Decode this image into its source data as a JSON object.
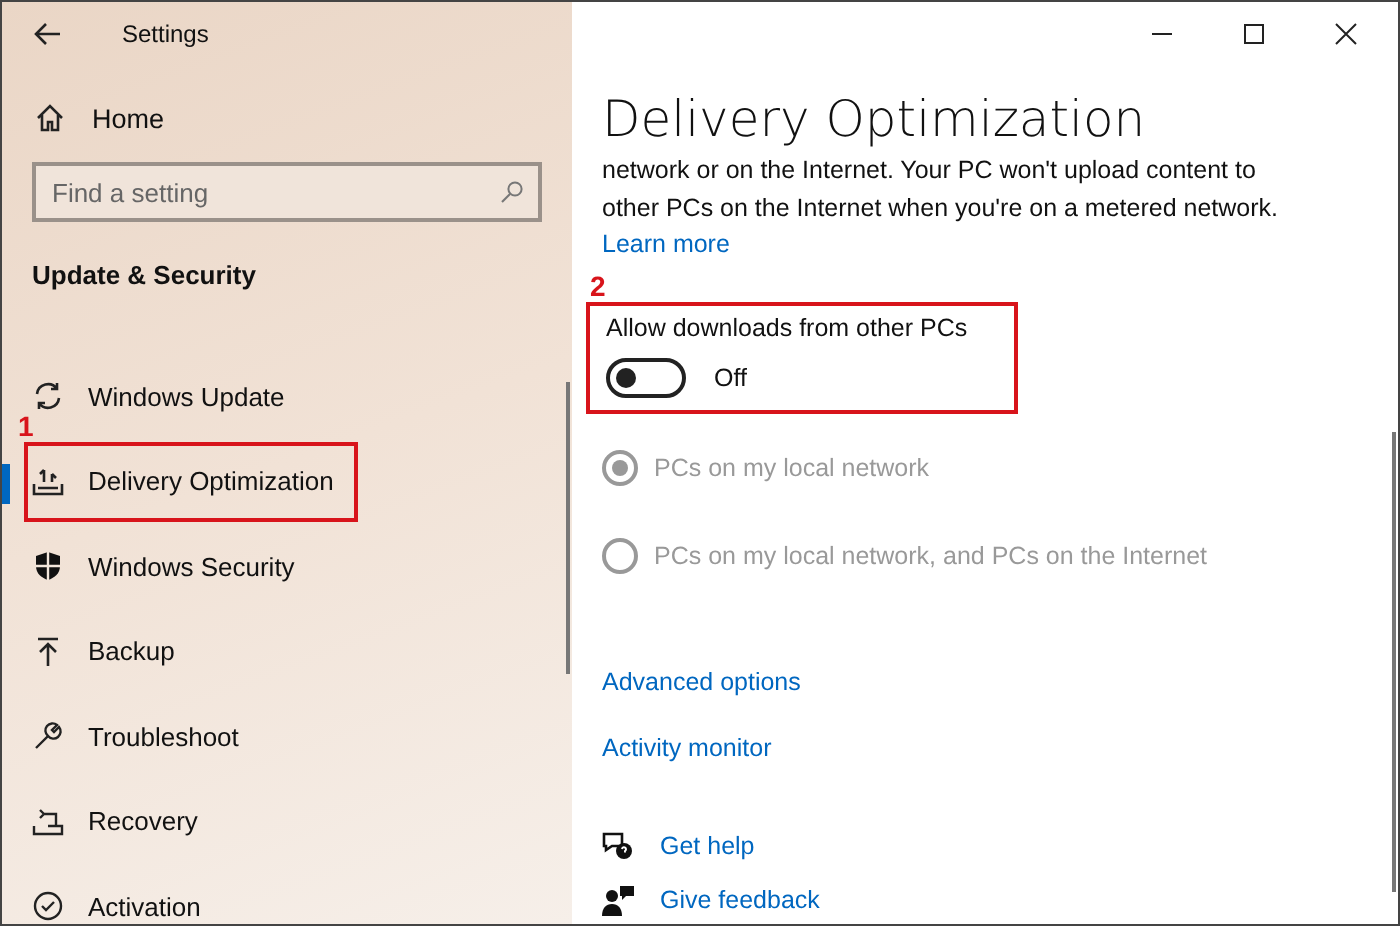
{
  "window": {
    "title": "Settings"
  },
  "sidebar": {
    "home": "Home",
    "search": {
      "placeholder": "Find a setting"
    },
    "section": "Update & Security",
    "items": [
      {
        "label": "Windows Update",
        "selected": false
      },
      {
        "label": "Delivery Optimization",
        "selected": true,
        "annotation": "1"
      },
      {
        "label": "Windows Security",
        "selected": false
      },
      {
        "label": "Backup",
        "selected": false
      },
      {
        "label": "Troubleshoot",
        "selected": false
      },
      {
        "label": "Recovery",
        "selected": false
      },
      {
        "label": "Activation",
        "selected": false
      }
    ]
  },
  "page": {
    "title": "Delivery Optimization",
    "description": "network or on the Internet. Your PC won't upload content to other PCs on the Internet when you're on a metered network.",
    "learn_more": "Learn more",
    "toggle": {
      "label": "Allow downloads from other PCs",
      "on": false,
      "state_text": "Off",
      "annotation": "2"
    },
    "radios": [
      {
        "label": "PCs on my local network",
        "selected": true,
        "disabled": true
      },
      {
        "label": "PCs on my local network, and PCs on the Internet",
        "selected": false,
        "disabled": true
      }
    ],
    "links": [
      "Advanced options",
      "Activity monitor"
    ],
    "help": [
      {
        "label": "Get help",
        "kind": "help"
      },
      {
        "label": "Give feedback",
        "kind": "feedback"
      }
    ]
  }
}
